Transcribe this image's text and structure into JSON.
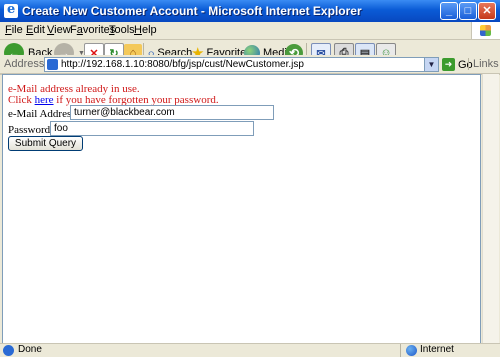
{
  "window": {
    "title": "Create New Customer Account - Microsoft Internet Explorer"
  },
  "menu": {
    "file": {
      "key": "F",
      "rest": "ile"
    },
    "edit": {
      "key": "E",
      "rest": "dit"
    },
    "view": {
      "key": "V",
      "rest": "iew"
    },
    "favorites": {
      "pre": "F",
      "key": "a",
      "rest": "vorites"
    },
    "tools": {
      "key": "T",
      "rest": "ools"
    },
    "help": {
      "key": "H",
      "rest": "elp"
    }
  },
  "toolbar": {
    "back_label": "Back",
    "search_label": "Search",
    "favorites_label": "Favorites",
    "media_label": "Media"
  },
  "address": {
    "label": "Address",
    "url": "http://192.168.1.10:8080/bfg/jsp/cust/NewCustomer.jsp",
    "go_label": "Go",
    "links_label": "Links"
  },
  "page": {
    "error_message": "e-Mail address already in use.",
    "forgot_prefix": "Click ",
    "forgot_link": "here",
    "forgot_suffix": " if you have forgotten your password.",
    "email_label": "e-Mail Address:",
    "email_value": "turner@blackbear.com",
    "password_label": "Password:",
    "password_value": "foo",
    "submit_label": "Submit Query"
  },
  "status": {
    "text": "Done",
    "zone": "Internet"
  },
  "colors": {
    "error": "#d01818",
    "link": "#0000ee",
    "title_bar": "#0a5bd6"
  }
}
